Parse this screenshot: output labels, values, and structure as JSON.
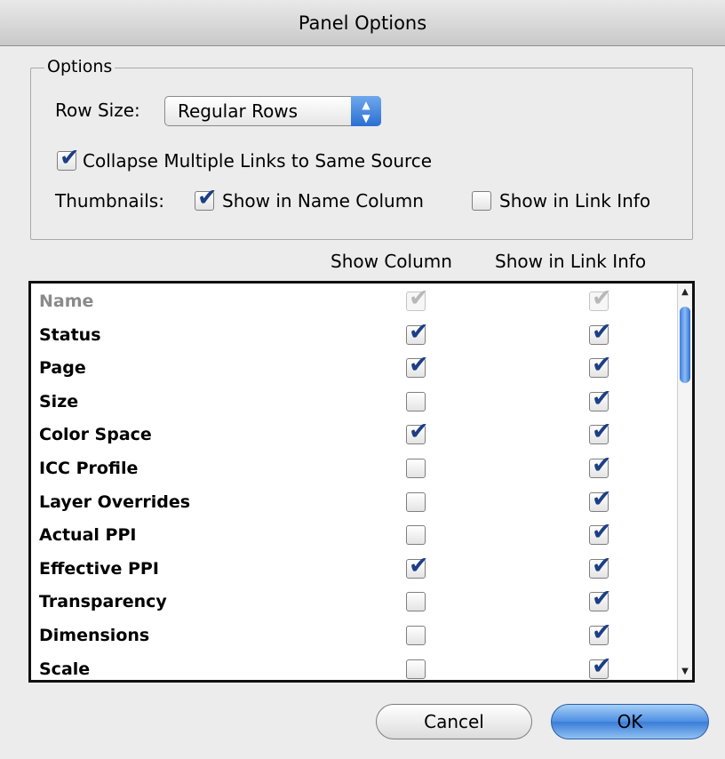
{
  "window": {
    "title": "Panel Options"
  },
  "options": {
    "legend": "Options",
    "row_size_label": "Row Size:",
    "row_size_value": "Regular Rows",
    "collapse_label": "Collapse Multiple Links to Same Source",
    "collapse_checked": true,
    "thumbnails_label": "Thumbnails:",
    "show_in_name_column_label": "Show in Name Column",
    "show_in_name_column_checked": true,
    "show_in_link_info_label": "Show in Link Info",
    "show_in_link_info_checked": false
  },
  "table": {
    "headers": {
      "show_column": "Show Column",
      "show_in_link_info": "Show in Link Info"
    },
    "rows": [
      {
        "label": "Name",
        "show_column": true,
        "show_in_link_info": true,
        "disabled": true
      },
      {
        "label": "Status",
        "show_column": true,
        "show_in_link_info": true
      },
      {
        "label": "Page",
        "show_column": true,
        "show_in_link_info": true
      },
      {
        "label": "Size",
        "show_column": false,
        "show_in_link_info": true
      },
      {
        "label": "Color Space",
        "show_column": true,
        "show_in_link_info": true
      },
      {
        "label": "ICC Profile",
        "show_column": false,
        "show_in_link_info": true
      },
      {
        "label": "Layer Overrides",
        "show_column": false,
        "show_in_link_info": true
      },
      {
        "label": "Actual PPI",
        "show_column": false,
        "show_in_link_info": true
      },
      {
        "label": "Effective PPI",
        "show_column": true,
        "show_in_link_info": true
      },
      {
        "label": "Transparency",
        "show_column": false,
        "show_in_link_info": true
      },
      {
        "label": "Dimensions",
        "show_column": false,
        "show_in_link_info": true
      },
      {
        "label": "Scale",
        "show_column": false,
        "show_in_link_info": true
      }
    ]
  },
  "buttons": {
    "cancel": "Cancel",
    "ok": "OK"
  },
  "colors": {
    "checkmark": "#1c3f86",
    "accent": "#3a7cd6"
  }
}
